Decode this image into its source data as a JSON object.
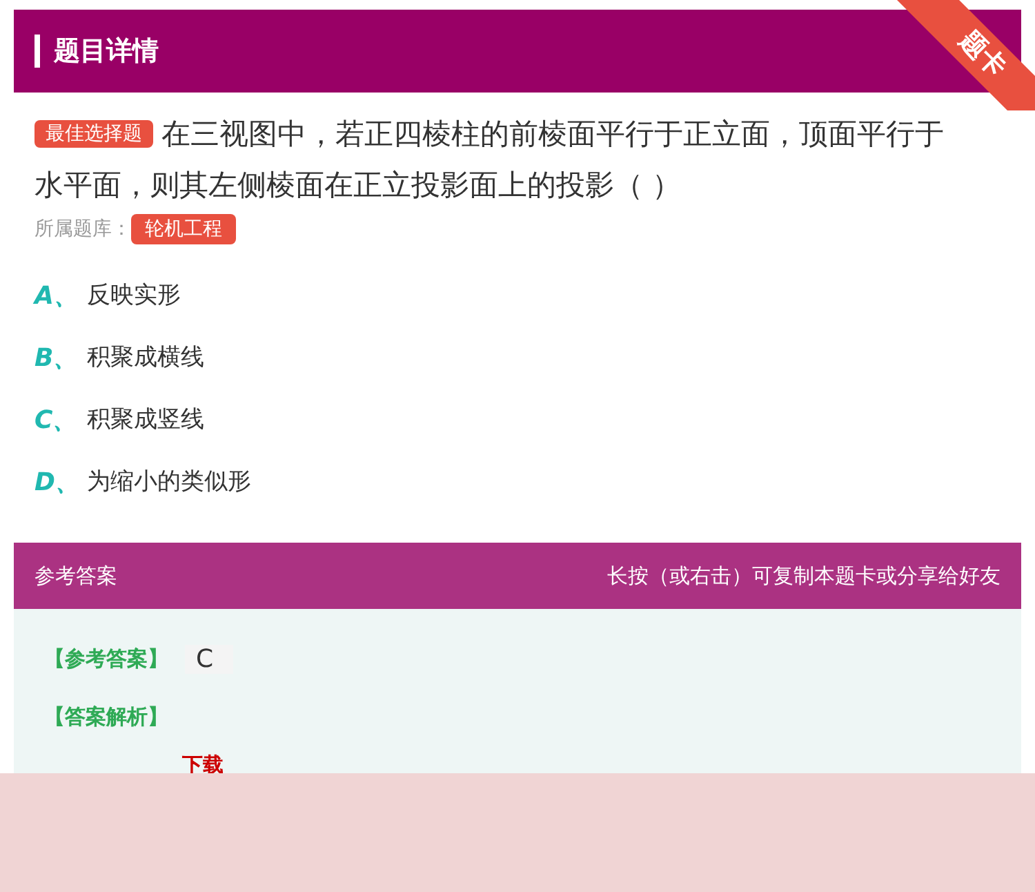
{
  "header": {
    "title": "题目详情",
    "corner_tag": "题卡"
  },
  "question": {
    "type_tag": "最佳选择题",
    "text": "在三视图中，若正四棱柱的前棱面平行于正立面，顶面平行于水平面，则其左侧棱面在正立投影面上的投影（ ）",
    "bank_label": "所属题库：",
    "bank_tag": "轮机工程"
  },
  "options": [
    {
      "letter": "A、",
      "text": "反映实形"
    },
    {
      "letter": "B、",
      "text": "积聚成横线"
    },
    {
      "letter": "C、",
      "text": "积聚成竖线"
    },
    {
      "letter": "D、",
      "text": "为缩小的类似形"
    }
  ],
  "answer_bar": {
    "title": "参考答案",
    "hint": "长按（或右击）可复制本题卡或分享给好友"
  },
  "answer": {
    "answer_label": "【参考答案】",
    "answer_value": "C",
    "analysis_label": "【答案解析】",
    "download_text": "下载"
  }
}
